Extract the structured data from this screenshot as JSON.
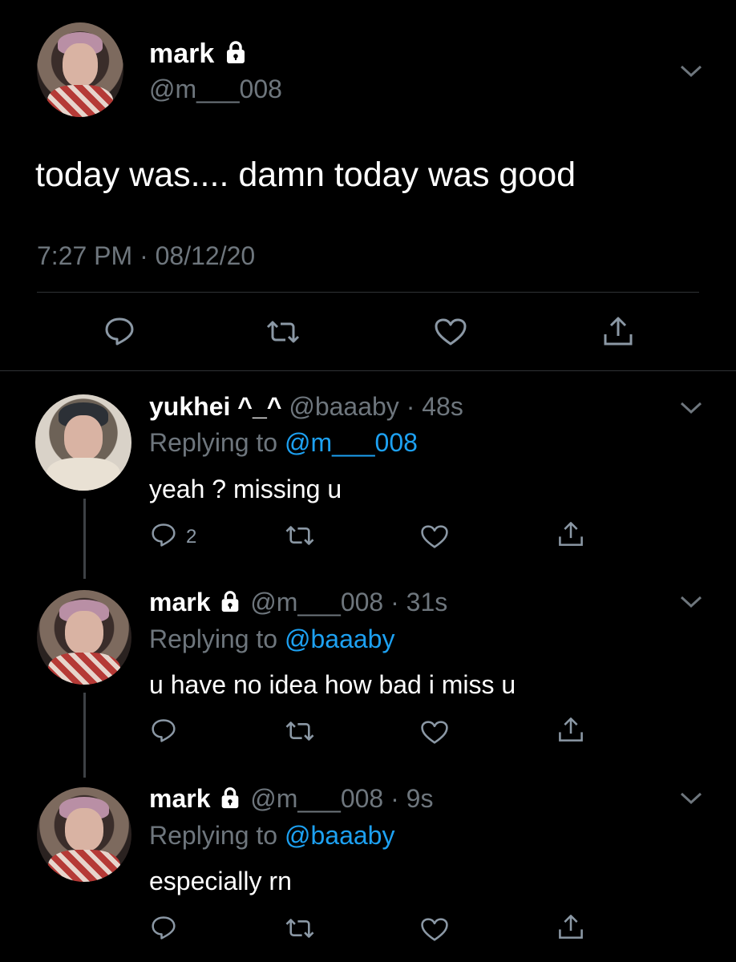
{
  "main_tweet": {
    "display_name": "mark",
    "handle": "@m___008",
    "text": "today was.... damn today was good",
    "timestamp": "7:27 PM · 08/12/20"
  },
  "replies": [
    {
      "display_name": "yukhei ^_^",
      "handle": "@baaaby",
      "time": "· 48s",
      "replying_prefix": "Replying to ",
      "replying_to": "@m___008",
      "text": "yeah ? missing u",
      "reply_count": "2",
      "locked": false
    },
    {
      "display_name": "mark",
      "handle": "@m___008",
      "time": "· 31s",
      "replying_prefix": "Replying to ",
      "replying_to": "@baaaby",
      "text": "u have no idea how bad i miss u",
      "reply_count": "",
      "locked": true
    },
    {
      "display_name": "mark",
      "handle": "@m___008",
      "time": "· 9s",
      "replying_prefix": "Replying to ",
      "replying_to": "@baaaby",
      "text": "especially rn",
      "reply_count": "",
      "locked": true
    }
  ],
  "colors": {
    "background": "#000000",
    "text": "#ffffff",
    "secondary": "#6e767d",
    "link": "#1da1f2"
  }
}
